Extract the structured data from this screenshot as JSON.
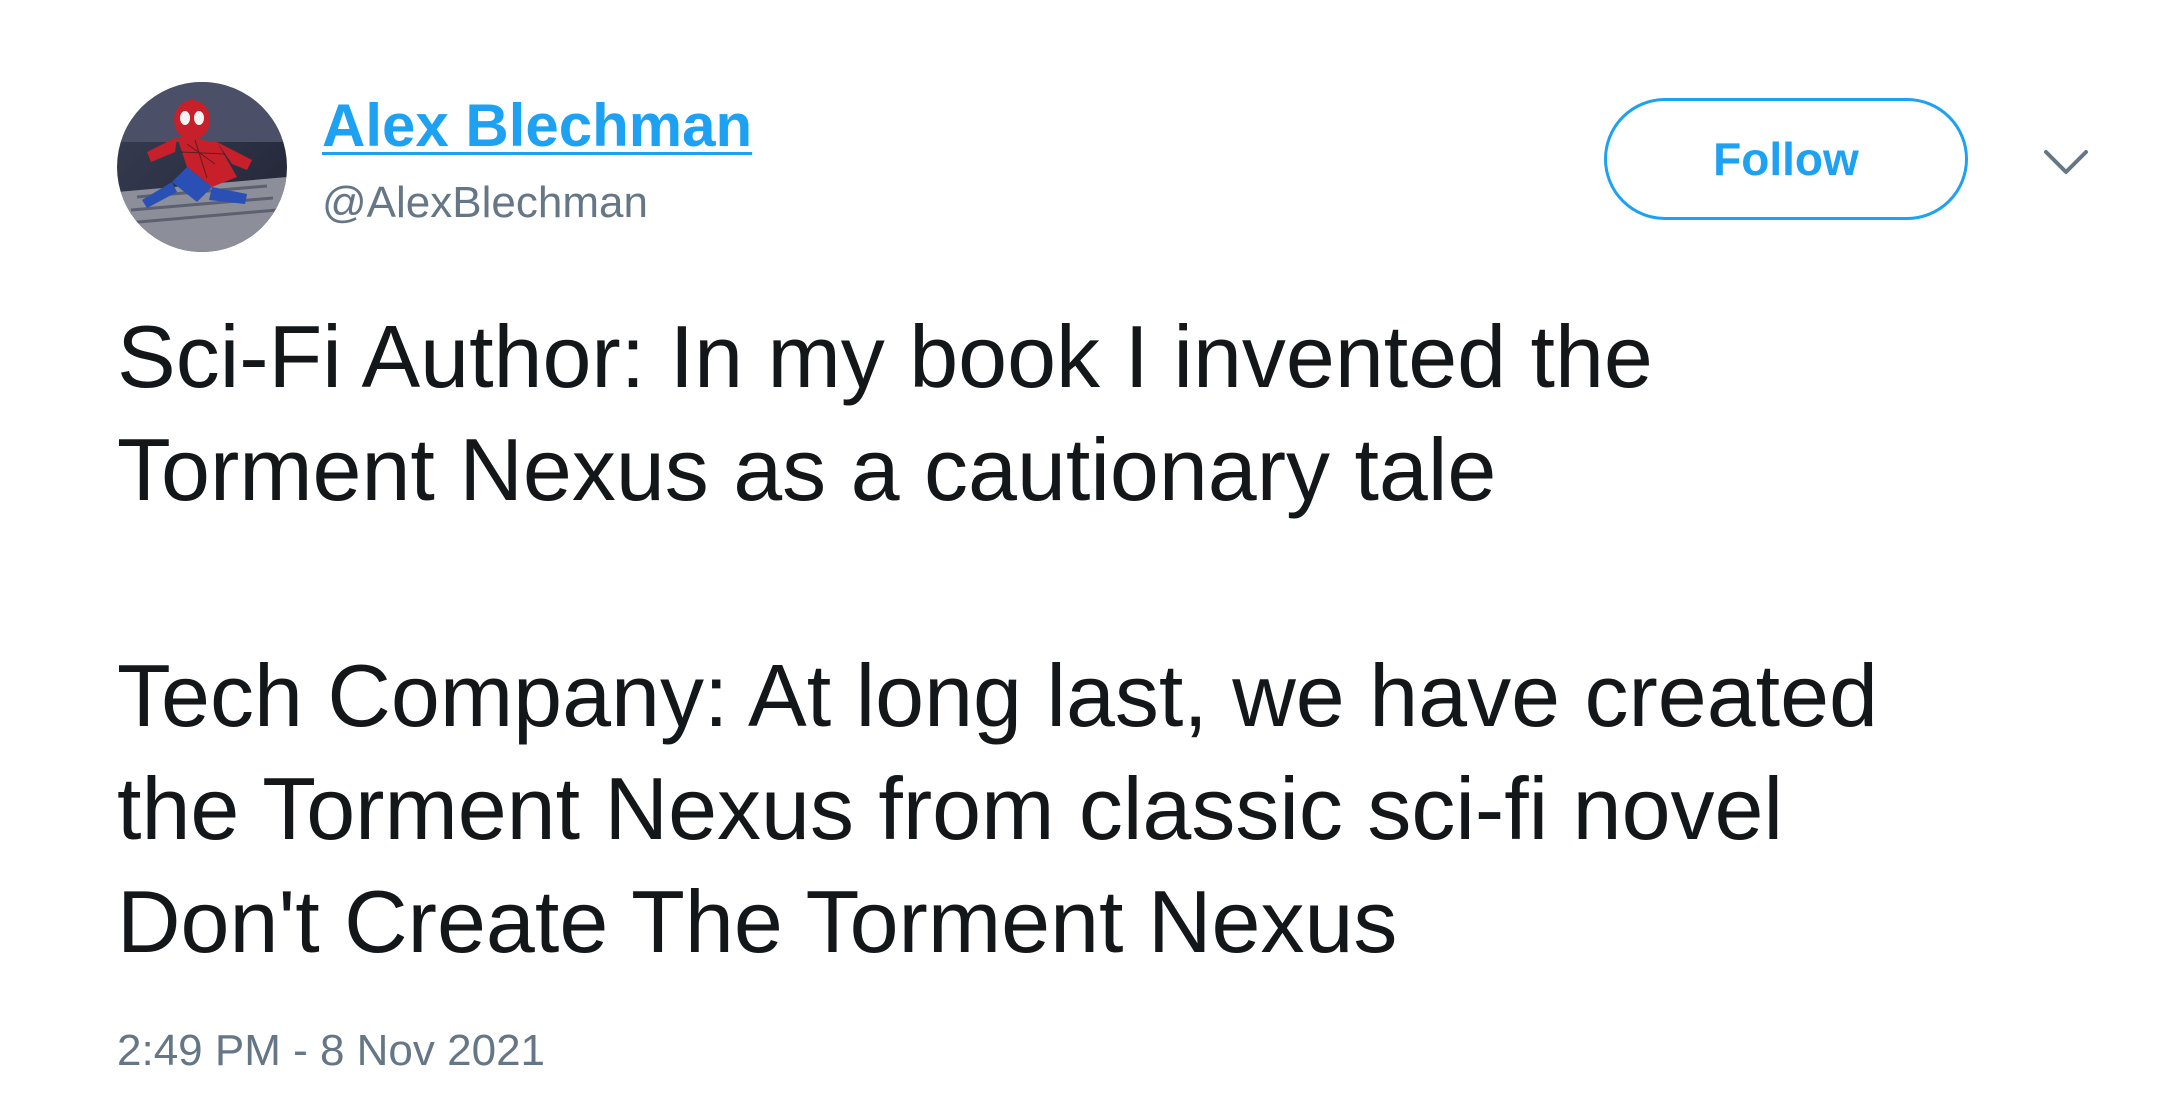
{
  "author": {
    "display_name": "Alex Blechman",
    "handle": "@AlexBlechman",
    "avatar": "spider-man-avatar"
  },
  "follow_button": {
    "label": "Follow"
  },
  "menu": {
    "icon": "chevron-down-icon"
  },
  "tweet": {
    "paragraphs": [
      {
        "lines": [
          "Sci-Fi Author: In my book I invented the",
          "Torment Nexus as a cautionary tale"
        ]
      },
      {
        "lines": [
          "Tech Company: At long last, we have created",
          "the Torment Nexus from classic sci-fi novel",
          "Don't Create The Torment Nexus"
        ]
      }
    ],
    "timestamp": "2:49 PM - 8 Nov 2021"
  },
  "colors": {
    "accent": "#1da1f2",
    "text": "#14171a",
    "secondary_text": "#657786",
    "background": "#ffffff"
  }
}
